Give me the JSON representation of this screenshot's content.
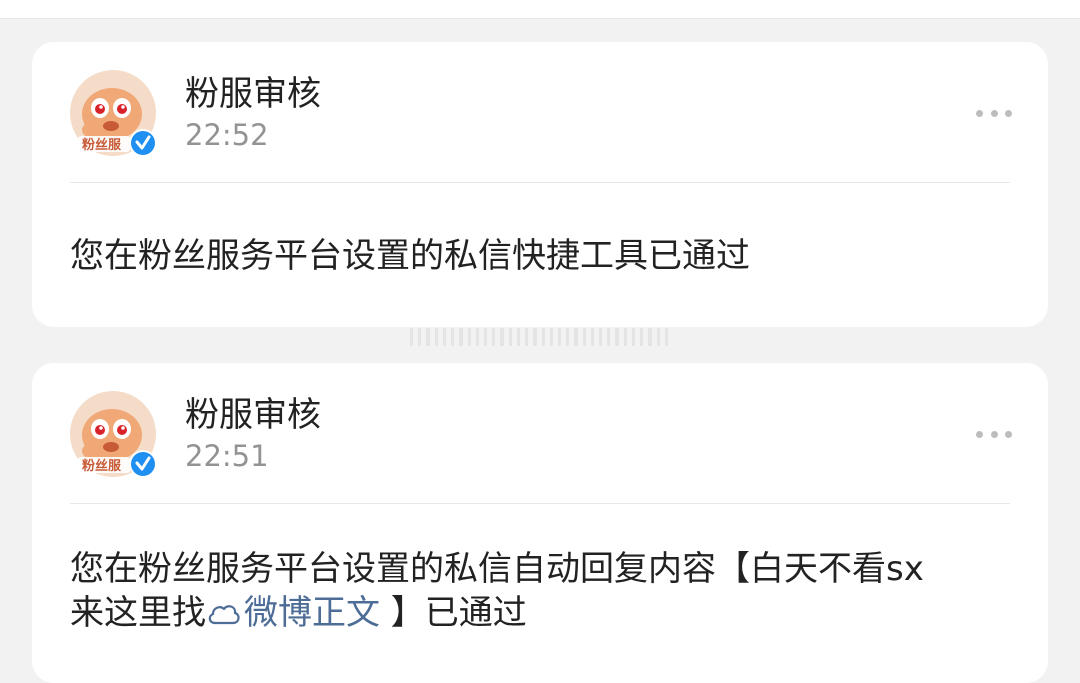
{
  "messages": [
    {
      "sender": "粉服审核",
      "time": "22:52",
      "lines": [
        "您在粉丝服务平台设置的私信快捷工具已通过"
      ],
      "link_text": "",
      "tail": ""
    },
    {
      "sender": "粉服审核",
      "time": "22:51",
      "lines": [
        "您在粉丝服务平台设置的私信自动回复内容【白天不看sx",
        "来这里找"
      ],
      "link_text": "微博正文",
      "tail": " 】已通过"
    }
  ],
  "avatar_badge_text": "粉丝服",
  "icons": {
    "more": "more-dots-icon",
    "verified": "verified-badge-icon",
    "link": "weibo-link-icon"
  },
  "colors": {
    "background": "#f2f2f2",
    "card": "#ffffff",
    "text": "#222222",
    "time": "#939393",
    "link": "#4d6c96",
    "verified": "#1f8ff2"
  }
}
